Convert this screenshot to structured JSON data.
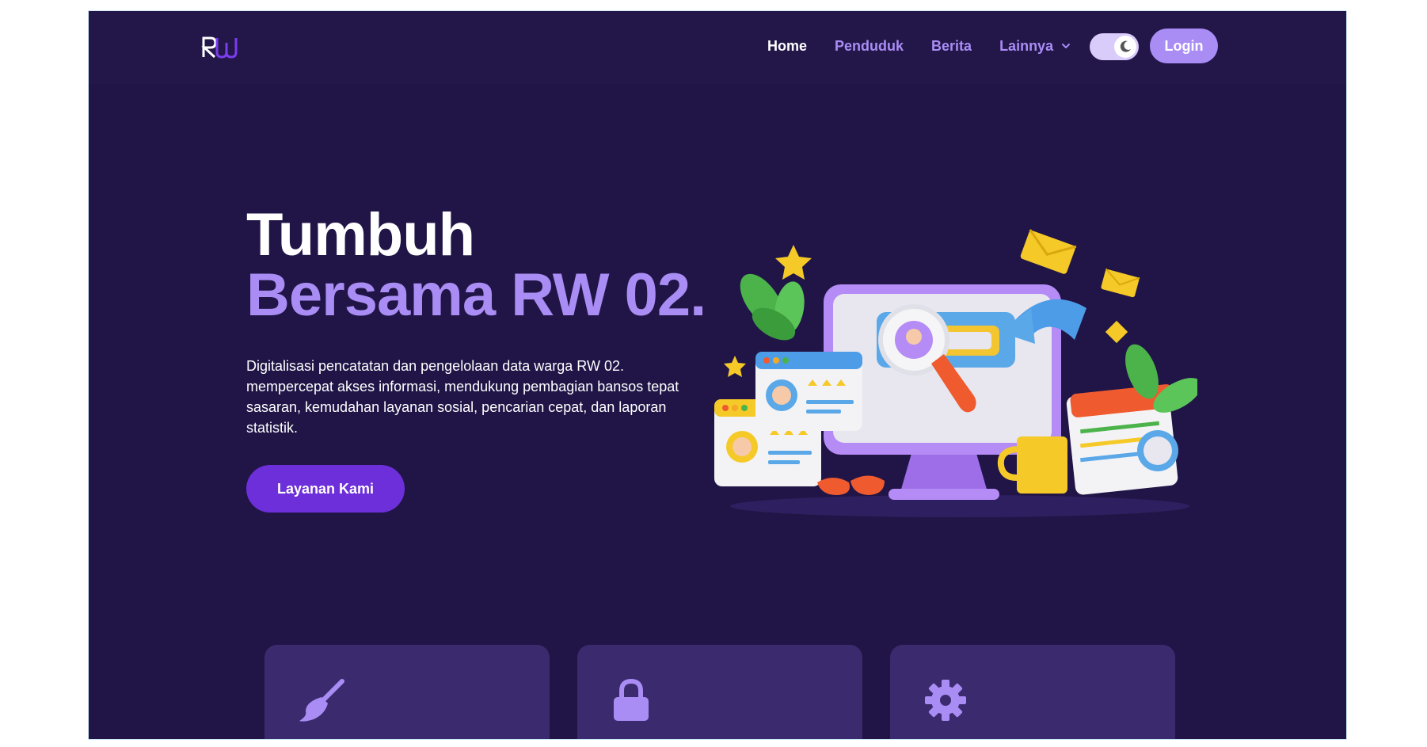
{
  "brand": {
    "logo_text": "RW"
  },
  "nav": {
    "links": [
      {
        "label": "Home",
        "active": true
      },
      {
        "label": "Penduduk",
        "active": false
      },
      {
        "label": "Berita",
        "active": false
      },
      {
        "label": "Lainnya",
        "active": false,
        "dropdown": true
      }
    ],
    "theme_toggle": {
      "icon": "moon-icon",
      "state": "dark"
    },
    "login_label": "Login"
  },
  "hero": {
    "title_line1": "Tumbuh",
    "title_line2": "Bersama RW 02.",
    "description": "Digitalisasi pencatatan dan pengelolaan data warga RW 02. mempercepat akses informasi, mendukung pembagian bansos tepat sasaran, kemudahan layanan sosial, pencarian cepat, dan laporan statistik.",
    "cta_label": "Layanan Kami"
  },
  "services": [
    {
      "icon": "broom-icon"
    },
    {
      "icon": "lock-icon"
    },
    {
      "icon": "gear-icon"
    }
  ],
  "colors": {
    "background": "#211547",
    "accent": "#a98df5",
    "cta": "#6d2fd9",
    "card": "#3b2b6e"
  }
}
